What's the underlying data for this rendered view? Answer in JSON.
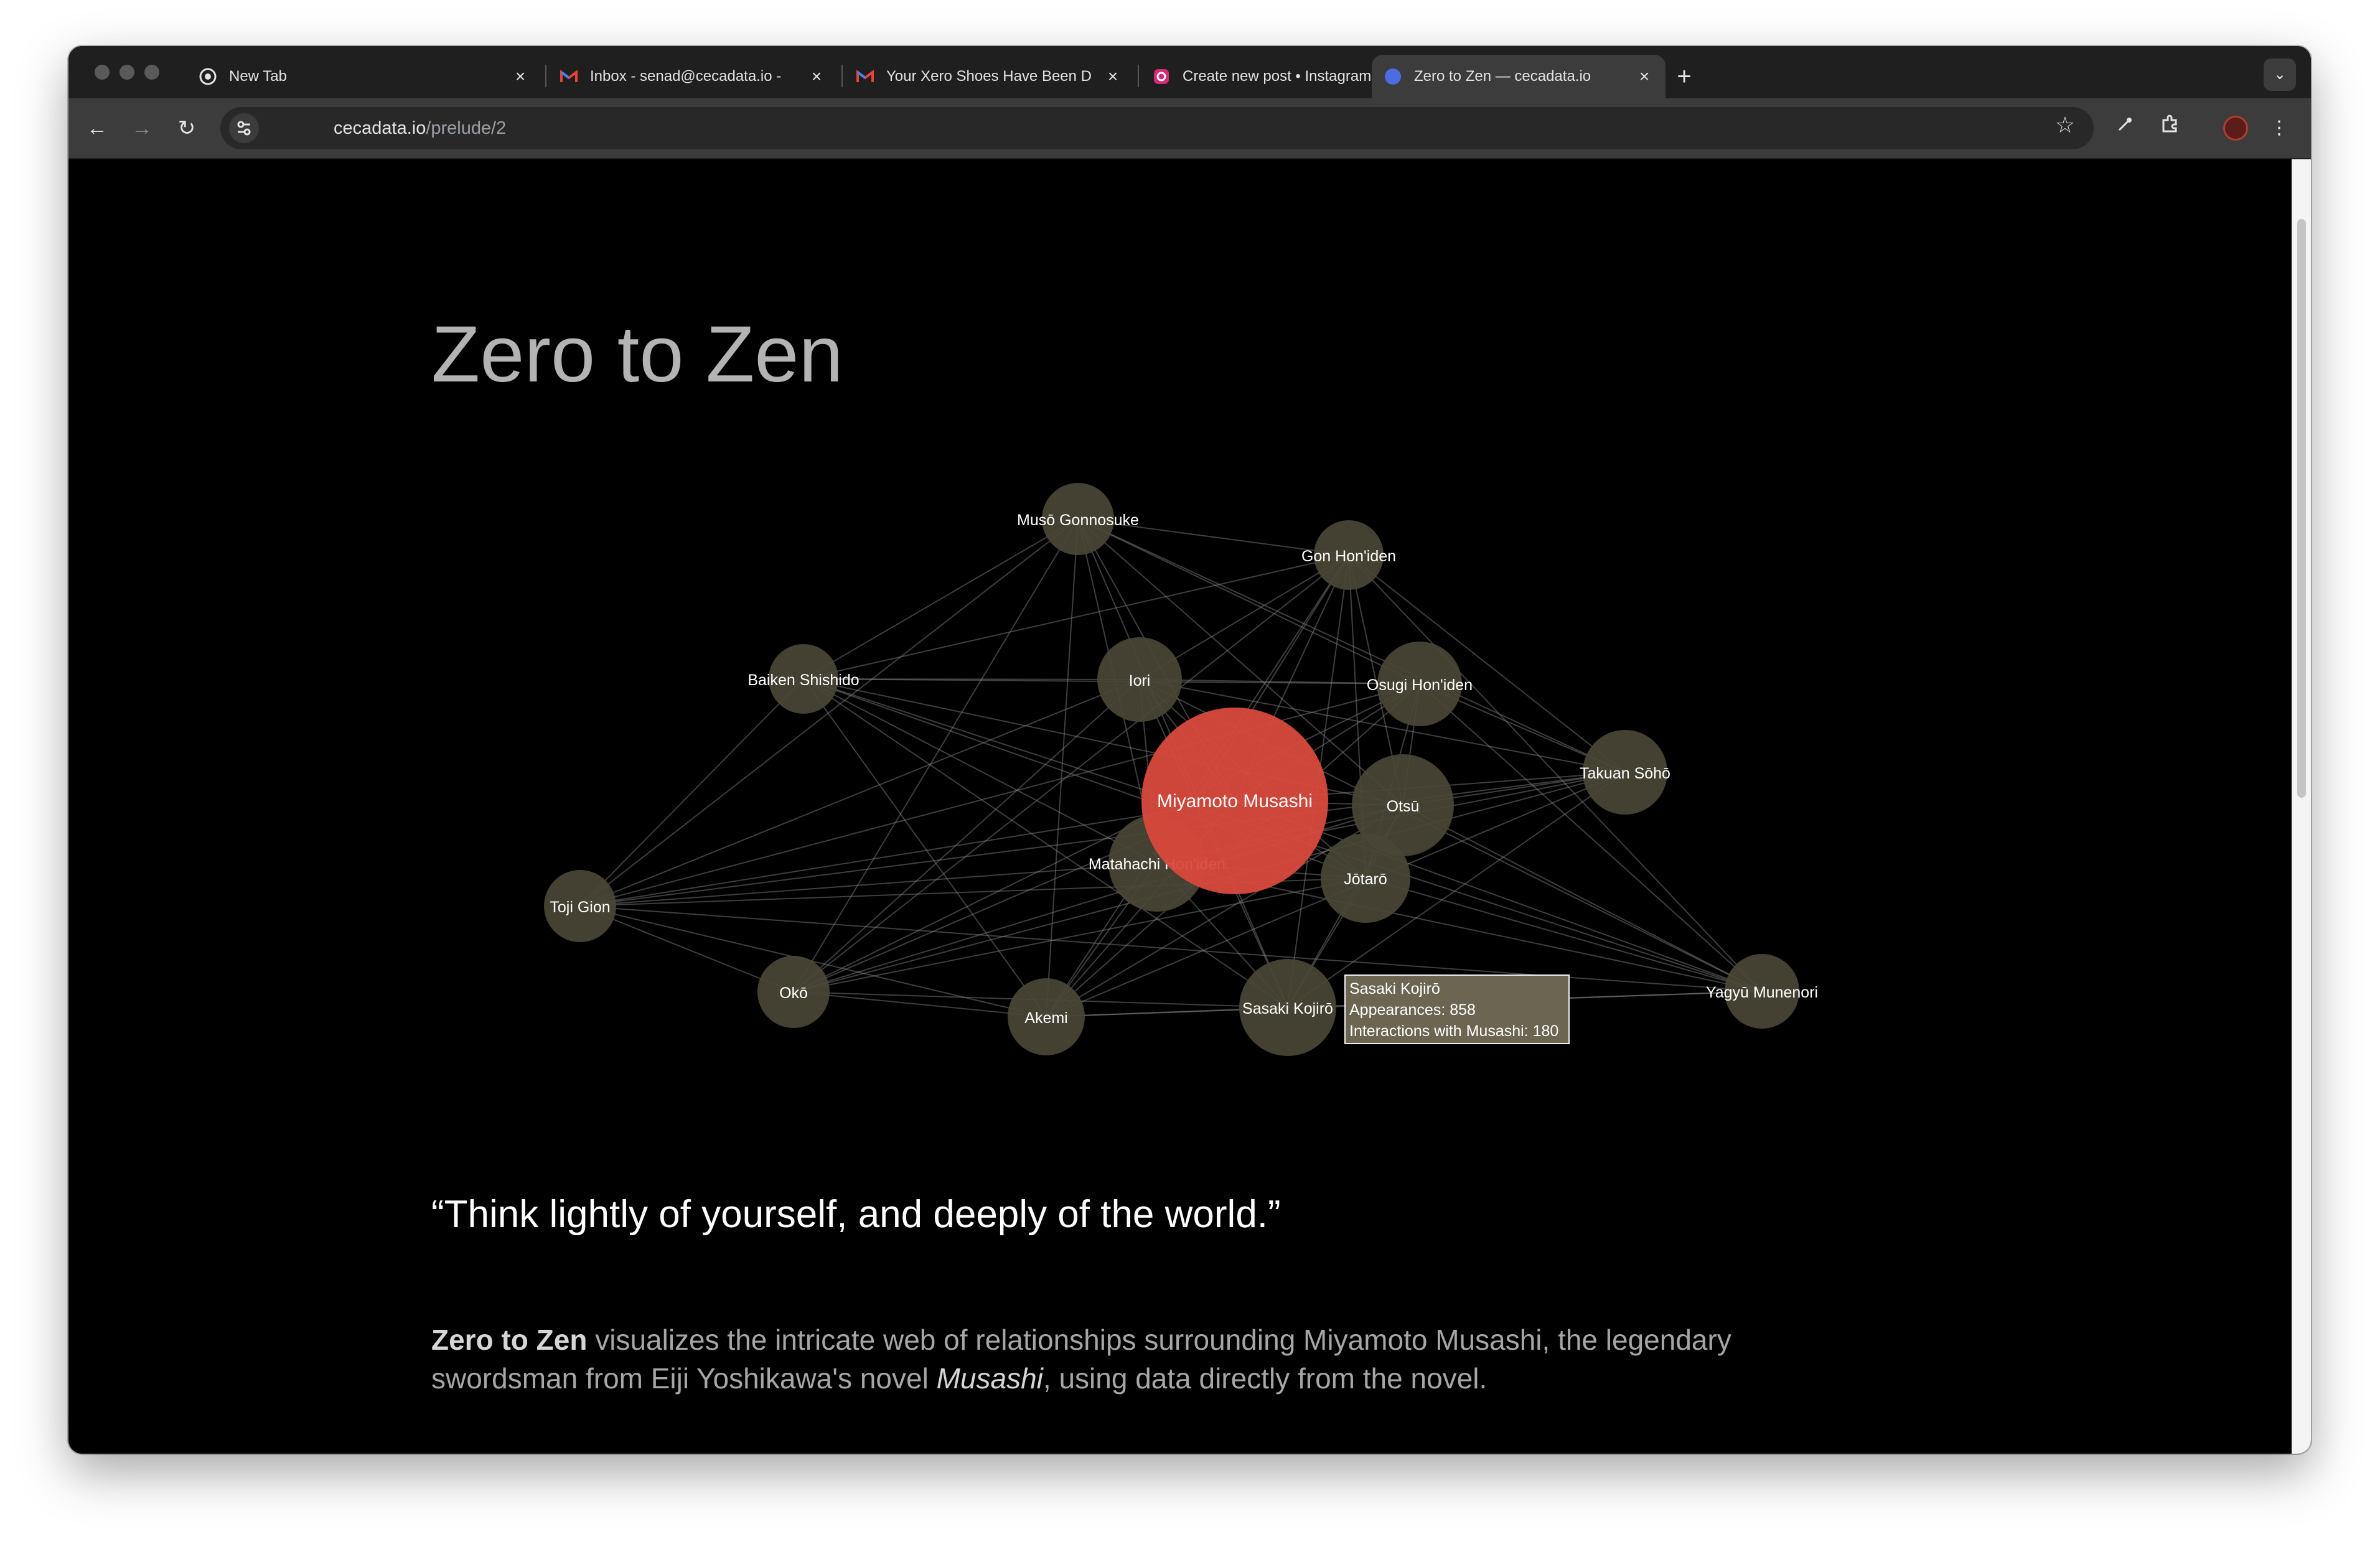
{
  "browser": {
    "tabs": [
      {
        "title": "New Tab",
        "icon": "chrome-icon"
      },
      {
        "title": "Inbox - senad@cecadata.io -",
        "icon": "gmail-icon"
      },
      {
        "title": "Your Xero Shoes Have Been D",
        "icon": "gmail-icon"
      },
      {
        "title": "Create new post • Instagram",
        "icon": "instagram-icon"
      },
      {
        "title": "Zero to Zen — cecadata.io",
        "icon": "globe-icon",
        "active": true
      }
    ],
    "url_host": "cecadata.io",
    "url_path": "/prelude/2"
  },
  "page": {
    "title": "Zero to Zen",
    "quote": "“Think lightly of yourself, and deeply of the world.”",
    "desc_bold": "Zero to Zen",
    "desc_part1": " visualizes the intricate web of relationships surrounding Miyamoto Musashi, the legendary swordsman from Eiji Yoshikawa's novel ",
    "desc_italic": "Musashi",
    "desc_part2": ", using data directly from the novel."
  },
  "graph": {
    "nodes": [
      {
        "name": "Miyamoto Musashi",
        "central": true
      },
      {
        "name": "Musō Gonnosuke"
      },
      {
        "name": "Gon Hon'iden"
      },
      {
        "name": "Baiken Shishido"
      },
      {
        "name": "Iori"
      },
      {
        "name": "Osugi Hon'iden"
      },
      {
        "name": "Takuan Sōhō"
      },
      {
        "name": "Otsū"
      },
      {
        "name": "Matahachi Hon'iden"
      },
      {
        "name": "Jōtarō"
      },
      {
        "name": "Toji Gion"
      },
      {
        "name": "Okō"
      },
      {
        "name": "Akemi"
      },
      {
        "name": "Sasaki Kojirō"
      },
      {
        "name": "Yagyū Munenori"
      }
    ],
    "tooltip": {
      "name": "Sasaki Kojirō",
      "appearances": "Appearances: 858",
      "interactions": "Interactions with Musashi: 180"
    },
    "colors": {
      "central": "#d9493c",
      "node": "#4a4536",
      "edge": "#8a8a8a",
      "tooltip_bg": "#6b6552"
    }
  }
}
